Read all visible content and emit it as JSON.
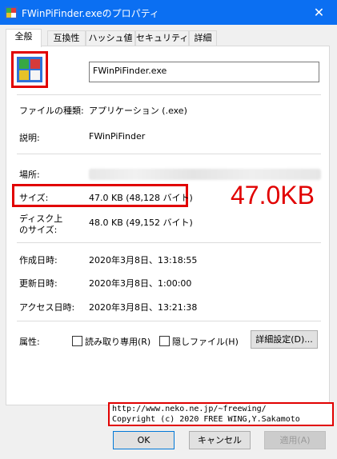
{
  "window": {
    "title": "FWinPiFinder.exeのプロパティ",
    "close_glyph": "✕"
  },
  "tabs": [
    {
      "label": "全般",
      "active": true
    },
    {
      "label": "互換性",
      "active": false
    },
    {
      "label": "ハッシュ値",
      "active": false
    },
    {
      "label": "セキュリティ",
      "active": false
    },
    {
      "label": "詳細",
      "active": false
    }
  ],
  "general": {
    "file_name": "FWinPiFinder.exe",
    "rows": {
      "type_label": "ファイルの種類:",
      "type_value": "アプリケーション (.exe)",
      "desc_label": "説明:",
      "desc_value": "FWinPiFinder",
      "location_label": "場所:",
      "size_label": "サイズ:",
      "size_value": "47.0 KB (48,128 バイト)",
      "disk_size_label_1": "ディスク上",
      "disk_size_label_2": "のサイズ:",
      "disk_size_value": "48.0 KB (49,152 バイト)",
      "created_label": "作成日時:",
      "created_value": "2020年3月8日、13:18:55",
      "modified_label": "更新日時:",
      "modified_value": "2020年3月8日、1:00:00",
      "accessed_label": "アクセス日時:",
      "accessed_value": "2020年3月8日、13:21:38"
    },
    "attributes": {
      "label": "属性:",
      "readonly_label": "読み取り専用(R)",
      "readonly_checked": false,
      "hidden_label": "隠しファイル(H)",
      "hidden_checked": false,
      "advanced_button": "詳細設定(D)..."
    }
  },
  "annotation": {
    "big_size_text": "47.0KB",
    "color": "#e10000",
    "credit_line1": "http://www.neko.ne.jp/~freewing/",
    "credit_line2": "Copyright (c) 2020 FREE WING,Y.Sakamoto"
  },
  "buttons": {
    "ok": "OK",
    "cancel": "キャンセル",
    "apply": "適用(A)"
  },
  "colors": {
    "titlebar": "#0b6ff2",
    "annotation_red": "#e10000"
  }
}
